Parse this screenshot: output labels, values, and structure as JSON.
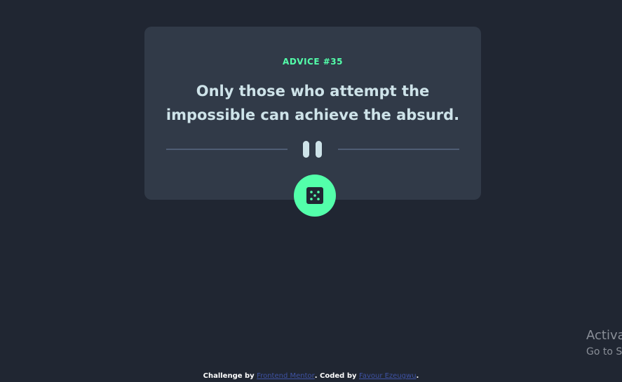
{
  "card": {
    "advice_id": "ADVICE #35",
    "quote_line1": "Only those who attempt the",
    "quote_line2": "impossible can achieve the absurd."
  },
  "footer": {
    "prefix": "Challenge by",
    "link1": "Frontend Mentor",
    "middle": ". Coded by",
    "link2": "Favour Ezeugwu",
    "suffix": "."
  },
  "watermark": {
    "line1": "Activa",
    "line2": "Go to Se"
  },
  "icons": {
    "dice": "dice-icon",
    "pause": "pause-icon"
  },
  "colors": {
    "background": "#202632",
    "card": "#313a48",
    "accent": "#53ffaa",
    "text": "#cee3e9",
    "divider": "#4f5d74",
    "link": "#3e52a3"
  }
}
